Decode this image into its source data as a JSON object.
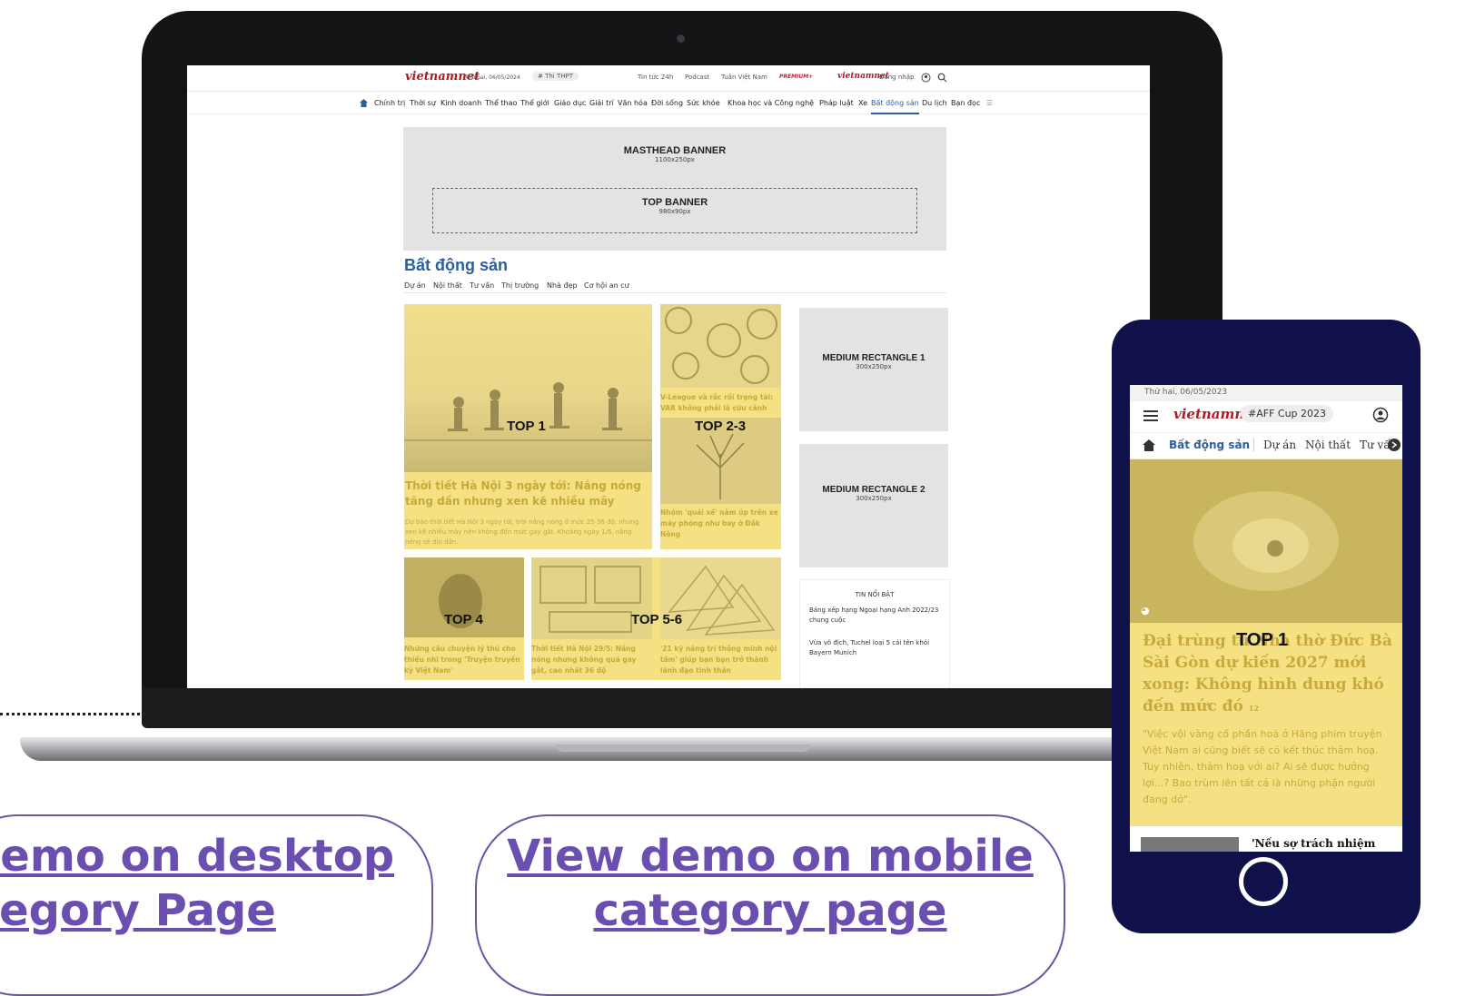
{
  "desktop": {
    "topbar": {
      "logo": "vietnamnet",
      "date": "Thứ hai, 06/05/2024",
      "tag": "# Thi THPT",
      "links": [
        "Tin tức 24h",
        "Podcast",
        "Tuần Việt Nam"
      ],
      "premium": "PREMIUM+",
      "login": "Đăng nhập"
    },
    "nav": [
      "Chính trị",
      "Thời sự",
      "Kinh doanh",
      "Thể thao",
      "Thế giới",
      "Giáo dục",
      "Giải trí",
      "Văn hóa",
      "Đời sống",
      "Sức khỏe",
      "Khoa học và Công nghệ",
      "Pháp luật",
      "Xe",
      "Bất động sản",
      "Du lịch",
      "Bạn đọc"
    ],
    "masthead": {
      "title": "MASTHEAD BANNER",
      "size": "1100x250px"
    },
    "top_banner": {
      "title": "TOP BANNER",
      "size": "980x90px"
    },
    "category": {
      "title": "Bất động sản",
      "tabs": [
        "Dự án",
        "Nội thất",
        "Tư vấn",
        "Thị trường",
        "Nhà đẹp",
        "Cơ hội an cư"
      ]
    },
    "top1": {
      "label": "TOP 1",
      "headline": "Thời tiết Hà Nội 3 ngày tới: Nắng nóng tăng dần nhưng xen kẽ nhiều mây",
      "summary": "Dự báo thời tiết Hà Nội 3 ngày tới, trời nắng nóng ở mức 35-36 độ, nhưng xen kẽ nhiều mây nên không đến mức gay gắt. Khoảng ngày 1/6, nắng nóng sẽ dịu dần."
    },
    "top23": {
      "label": "TOP 2-3",
      "headline_a": "V-League và rắc rối trọng tài: VAR không phải là cứu cánh",
      "headline_b": "Nhóm 'quái xế' nằm úp trên xe máy phóng như bay ở Đắk Nông"
    },
    "top4": {
      "label": "TOP 4",
      "headline": "Những câu chuyện lý thú cho thiếu nhi trong 'Truyện truyền kỳ Việt Nam'"
    },
    "top56": {
      "label": "TOP 5-6",
      "headline_a": "Thời tiết Hà Nội 29/5: Nắng nóng nhưng không quá gay gắt, cao nhất 36 độ",
      "headline_b": "'21 kỹ năng trí thông minh nội tâm' giúp bạn bạn trở thành lãnh đạo tinh thần"
    },
    "rect1": {
      "title": "MEDIUM RECTANGLE 1",
      "size": "300x250px"
    },
    "rect2": {
      "title": "MEDIUM RECTANGLE 2",
      "size": "300x250px"
    },
    "featured": {
      "title": "TIN NỔI BẬT",
      "items": [
        "Bảng xếp hạng Ngoại hạng Anh 2022/23 chung cuộc",
        "Vừa vô địch, Tuchel loại 5 cái tên khỏi Bayern Munich"
      ]
    }
  },
  "mobile": {
    "date": "Thứ hai, 06/05/2023",
    "logo": "vietnamnet",
    "tag": "#AFF Cup 2023",
    "nav": {
      "category": "Bất động sản",
      "items": [
        "Dự án",
        "Nội thất",
        "Tư vấn"
      ]
    },
    "top1": {
      "label": "TOP 1",
      "headline": "Đại trùng tu Nhà thờ Đức Bà Sài Gòn dự kiến 2027 mới xong: Không hình dung khó đến mức đó",
      "comments": "12",
      "summary": "\"Việc vội vàng cố phần hoá ở Hãng phim truyện Việt Nam ai cũng biết sẽ có kết thúc thảm hoạ. Tuy nhiên, thảm hoạ với ai? Ai sẽ được hưởng lợi...? Bao trùm lên tất cả là những phận người đang dở\"."
    },
    "next_headline": "'Nếu sợ trách nhiệm"
  },
  "buttons": {
    "desktop_line1": "demo on desktop",
    "desktop_line2": "tegory Page",
    "mobile_line1": "View demo on mobile",
    "mobile_line2": "category page"
  },
  "colors": {
    "accent": "#6b4fb0",
    "phone_frame": "#10104a",
    "highlight": "#f5e183",
    "brand_red": "#b11a21",
    "link_blue": "#2b5fa0"
  }
}
